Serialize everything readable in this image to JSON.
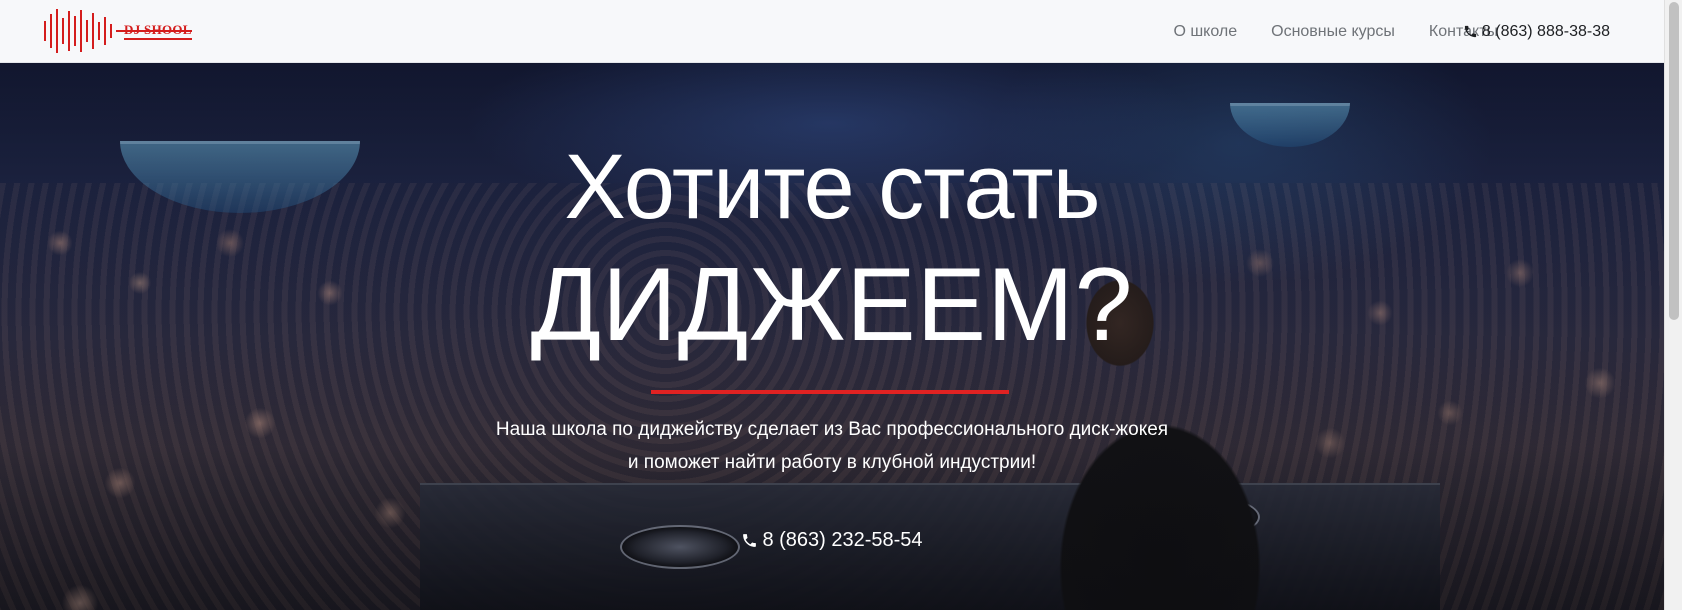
{
  "navbar": {
    "logo_text": "DJ SHOOL",
    "links": [
      "О школе",
      "Основные курсы",
      "Контакты"
    ],
    "phone": "8 (863) 888-38-38"
  },
  "hero": {
    "headline_line1": "Хотите стать",
    "headline_line2": "ДИДЖЕЕМ?",
    "subtitle_line1": "Наша школа по диджейству сделает из Вас профессионального диск-жокея",
    "subtitle_line2": "и поможет найти работу в клубной индустрии!",
    "phone": "8 (863) 232-58-54"
  },
  "colors": {
    "accent": "#e02222",
    "logo": "#d41d1d",
    "nav_bg": "#f7f8fa",
    "nav_text": "#6f7378"
  },
  "icons": {
    "logo": "sound-wave-icon",
    "phone": "phone-icon"
  }
}
